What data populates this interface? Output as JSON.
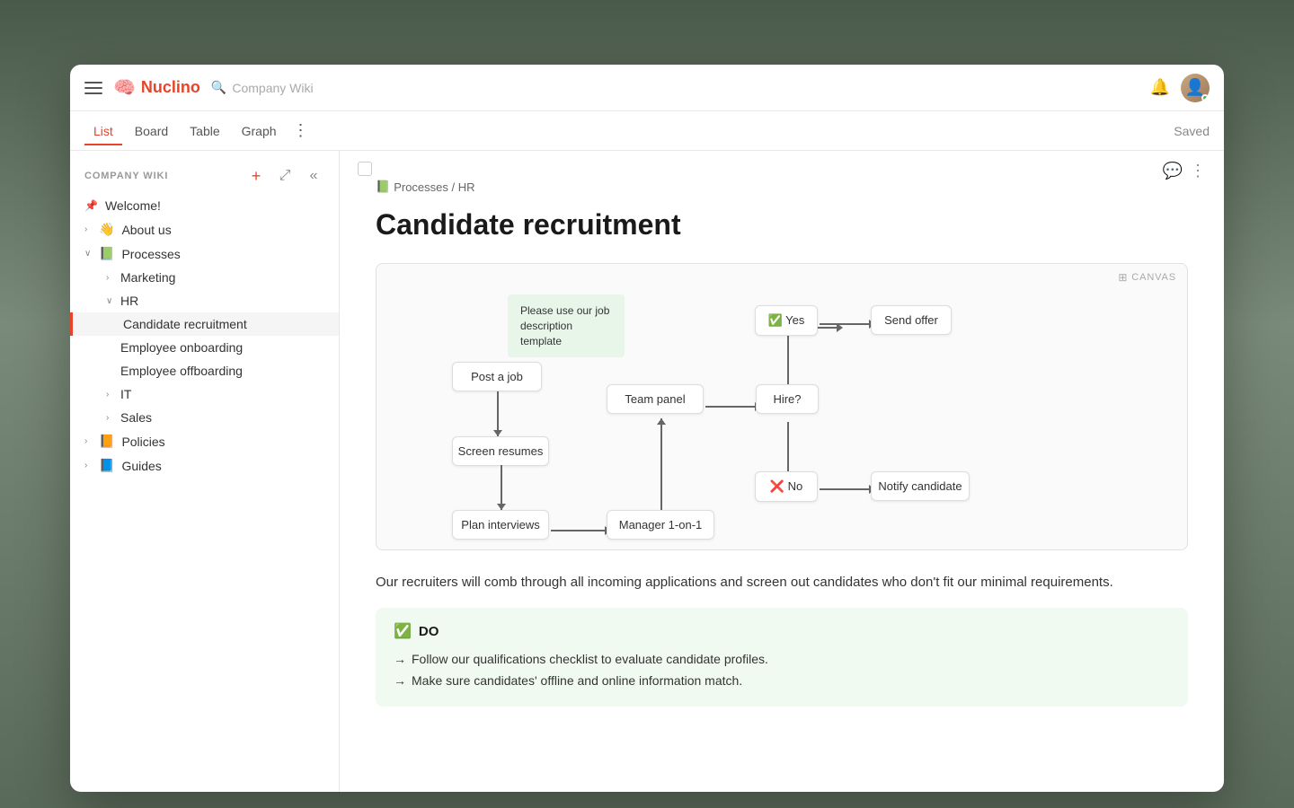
{
  "app": {
    "name": "Nuclino",
    "search_placeholder": "Company Wiki"
  },
  "topbar": {
    "saved_label": "Saved"
  },
  "nav_tabs": [
    {
      "id": "list",
      "label": "List",
      "active": true
    },
    {
      "id": "board",
      "label": "Board",
      "active": false
    },
    {
      "id": "table",
      "label": "Table",
      "active": false
    },
    {
      "id": "graph",
      "label": "Graph",
      "active": false
    }
  ],
  "sidebar": {
    "title": "COMPANY WIKI",
    "items": [
      {
        "id": "welcome",
        "label": "Welcome!",
        "icon": "📌",
        "level": 0,
        "pinned": true
      },
      {
        "id": "about-us",
        "label": "About us",
        "icon": "👋",
        "level": 0,
        "has_children": true
      },
      {
        "id": "processes",
        "label": "Processes",
        "icon": "📗",
        "level": 0,
        "has_children": true,
        "expanded": true
      },
      {
        "id": "marketing",
        "label": "Marketing",
        "level": 1,
        "has_children": true
      },
      {
        "id": "hr",
        "label": "HR",
        "level": 1,
        "has_children": true,
        "expanded": true
      },
      {
        "id": "candidate-recruitment",
        "label": "Candidate recruitment",
        "level": 2,
        "active": true
      },
      {
        "id": "employee-onboarding",
        "label": "Employee onboarding",
        "level": 2
      },
      {
        "id": "employee-offboarding",
        "label": "Employee offboarding",
        "level": 2
      },
      {
        "id": "it",
        "label": "IT",
        "level": 1,
        "has_children": true
      },
      {
        "id": "sales",
        "label": "Sales",
        "level": 1,
        "has_children": true
      },
      {
        "id": "policies",
        "label": "Policies",
        "icon": "📙",
        "level": 0,
        "has_children": true
      },
      {
        "id": "guides",
        "label": "Guides",
        "icon": "📘",
        "level": 0,
        "has_children": true
      }
    ]
  },
  "page": {
    "breadcrumb_icon": "📗",
    "breadcrumb_path": "Processes / HR",
    "title": "Candidate recruitment",
    "canvas_label": "CANVAS",
    "body_text": "Our recruiters will comb through all incoming applications and screen out candidates who don't fit our minimal requirements.",
    "do_section": {
      "title": "DO",
      "items": [
        "Follow our qualifications checklist to evaluate candidate profiles.",
        "Make sure candidates' offline and online information match."
      ]
    }
  },
  "flow": {
    "note": "Please use our job description template",
    "nodes": [
      {
        "id": "post-job",
        "label": "Post a job"
      },
      {
        "id": "screen-resumes",
        "label": "Screen resumes"
      },
      {
        "id": "plan-interviews",
        "label": "Plan interviews"
      },
      {
        "id": "manager-1on1",
        "label": "Manager 1-on-1"
      },
      {
        "id": "team-panel",
        "label": "Team panel"
      },
      {
        "id": "hire",
        "label": "Hire?"
      },
      {
        "id": "yes",
        "label": "✅ Yes"
      },
      {
        "id": "send-offer",
        "label": "Send offer"
      },
      {
        "id": "no",
        "label": "❌ No"
      },
      {
        "id": "notify-candidate",
        "label": "Notify candidate"
      }
    ]
  }
}
